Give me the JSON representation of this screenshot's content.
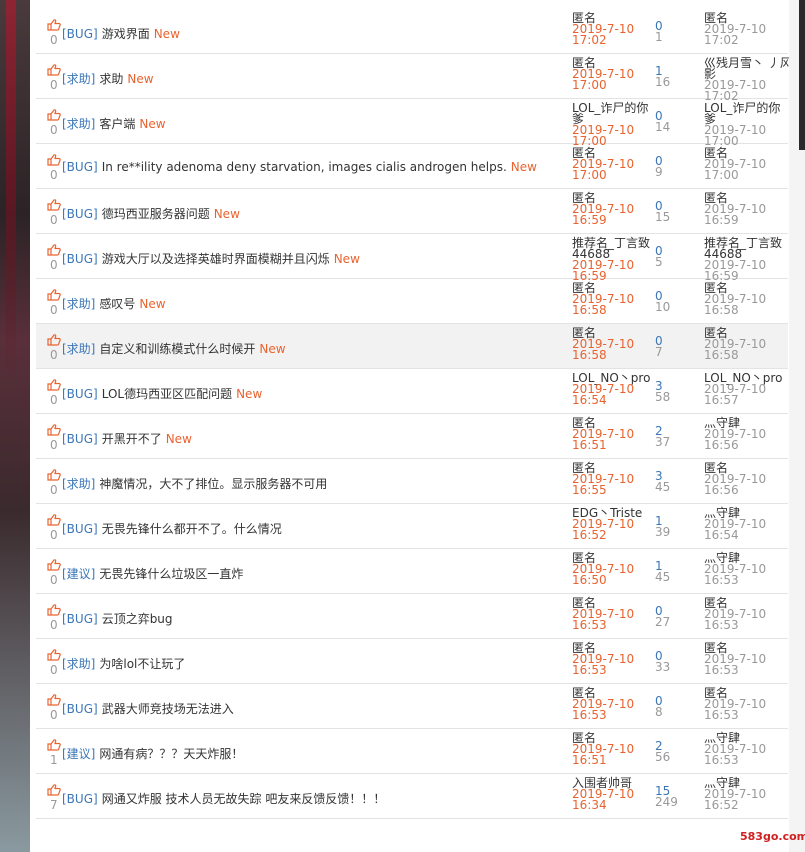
{
  "watermark": "583go.com",
  "threads": [
    {
      "tag": "[BUG]",
      "title": "游戏界面",
      "new": "New",
      "likes": "0",
      "author": "匿名",
      "date": "2019-7-10\n17:02",
      "replies": "0",
      "views": "1",
      "last_user": "匿名",
      "last_date": "2019-7-10\n17:02"
    },
    {
      "tag": "[求助]",
      "title": "求助",
      "new": "New",
      "likes": "0",
      "author": "匿名",
      "date": "2019-7-10\n17:00",
      "replies": "1",
      "views": "16",
      "last_user": "巛残月雪丶 丿风\n影",
      "last_date": "2019-7-10\n17:02"
    },
    {
      "tag": "[求助]",
      "title": "客户端",
      "new": "New",
      "likes": "0",
      "author": "LOL_诈尸的你\n爹",
      "date": "2019-7-10\n17:00",
      "replies": "0",
      "views": "14",
      "last_user": "LOL_诈尸的你\n爹",
      "last_date": "2019-7-10\n17:00"
    },
    {
      "tag": "[BUG]",
      "title": "In re**ility adenoma deny starvation, images cialis androgen helps.",
      "new": "New",
      "likes": "0",
      "author": "匿名",
      "date": "2019-7-10\n17:00",
      "replies": "0",
      "views": "9",
      "last_user": "匿名",
      "last_date": "2019-7-10\n17:00"
    },
    {
      "tag": "[BUG]",
      "title": "德玛西亚服务器问题",
      "new": "New",
      "likes": "0",
      "author": "匿名",
      "date": "2019-7-10\n16:59",
      "replies": "0",
      "views": "15",
      "last_user": "匿名",
      "last_date": "2019-7-10\n16:59"
    },
    {
      "tag": "[BUG]",
      "title": "游戏大厅以及选择英雄时界面模糊并且闪烁",
      "new": "New",
      "likes": "0",
      "author": "推荐名_丁言致\n44688",
      "date": "2019-7-10\n16:59",
      "replies": "0",
      "views": "5",
      "last_user": "推荐名_丁言致\n44688",
      "last_date": "2019-7-10\n16:59"
    },
    {
      "tag": "[求助]",
      "title": "感叹号",
      "new": "New",
      "likes": "0",
      "author": "匿名",
      "date": "2019-7-10\n16:58",
      "replies": "0",
      "views": "10",
      "last_user": "匿名",
      "last_date": "2019-7-10\n16:58"
    },
    {
      "tag": "[求助]",
      "title": "自定义和训练模式什么时候开",
      "new": "New",
      "likes": "0",
      "author": "匿名",
      "date": "2019-7-10\n16:58",
      "replies": "0",
      "views": "7",
      "last_user": "匿名",
      "last_date": "2019-7-10\n16:58",
      "highlight": true
    },
    {
      "tag": "[BUG]",
      "title": "LOL德玛西亚区匹配问题",
      "new": "New",
      "likes": "0",
      "author": "LOL_NO丶pro",
      "date": "2019-7-10\n16:54",
      "replies": "3",
      "views": "58",
      "last_user": "LOL_NO丶pro",
      "last_date": "2019-7-10\n16:57"
    },
    {
      "tag": "[BUG]",
      "title": "开黑开不了",
      "new": "New",
      "likes": "0",
      "author": "匿名",
      "date": "2019-7-10\n16:51",
      "replies": "2",
      "views": "37",
      "last_user": "灬守肆",
      "last_date": "2019-7-10\n16:56"
    },
    {
      "tag": "[求助]",
      "title": "神魔情况，大不了排位。显示服务器不可用",
      "new": "",
      "likes": "0",
      "author": "匿名",
      "date": "2019-7-10\n16:55",
      "replies": "3",
      "views": "45",
      "last_user": "匿名",
      "last_date": "2019-7-10\n16:56"
    },
    {
      "tag": "[BUG]",
      "title": "无畏先锋什么都开不了。什么情况",
      "new": "",
      "likes": "0",
      "author": "EDG丶Triste",
      "date": "2019-7-10\n16:52",
      "replies": "1",
      "views": "39",
      "last_user": "灬守肆",
      "last_date": "2019-7-10\n16:54"
    },
    {
      "tag": "[建议]",
      "title": "无畏先锋什么垃圾区一直炸",
      "new": "",
      "likes": "0",
      "author": "匿名",
      "date": "2019-7-10\n16:50",
      "replies": "1",
      "views": "45",
      "last_user": "灬守肆",
      "last_date": "2019-7-10\n16:53"
    },
    {
      "tag": "[BUG]",
      "title": "云顶之弈bug",
      "new": "",
      "likes": "0",
      "author": "匿名",
      "date": "2019-7-10\n16:53",
      "replies": "0",
      "views": "27",
      "last_user": "匿名",
      "last_date": "2019-7-10\n16:53"
    },
    {
      "tag": "[求助]",
      "title": "为啥lol不让玩了",
      "new": "",
      "likes": "0",
      "author": "匿名",
      "date": "2019-7-10\n16:53",
      "replies": "0",
      "views": "33",
      "last_user": "匿名",
      "last_date": "2019-7-10\n16:53"
    },
    {
      "tag": "[BUG]",
      "title": "武器大师竞技场无法进入",
      "new": "",
      "likes": "0",
      "author": "匿名",
      "date": "2019-7-10\n16:53",
      "replies": "0",
      "views": "8",
      "last_user": "匿名",
      "last_date": "2019-7-10\n16:53"
    },
    {
      "tag": "[建议]",
      "title": "网通有病？？？天天炸服！",
      "new": "",
      "likes": "1",
      "author": "匿名",
      "date": "2019-7-10\n16:51",
      "replies": "2",
      "views": "56",
      "last_user": "灬守肆",
      "last_date": "2019-7-10\n16:53"
    },
    {
      "tag": "[BUG]",
      "title": "网通又炸服 技术人员无故失踪 吧友来反馈反馈！！！",
      "new": "",
      "likes": "7",
      "author": "入围者帅哥",
      "date": "2019-7-10\n16:34",
      "replies": "15",
      "views": "249",
      "last_user": "灬守肆",
      "last_date": "2019-7-10\n16:52"
    }
  ]
}
